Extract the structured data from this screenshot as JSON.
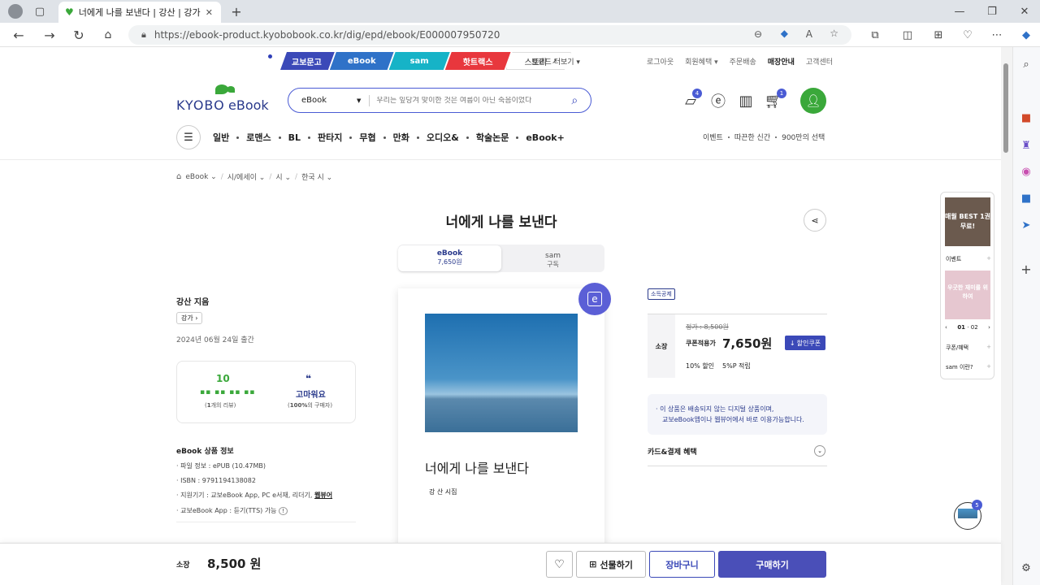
{
  "browser": {
    "tab_title": "너에게 나를 보낸다 | 강산 | 강가",
    "url": "https://ebook-product.kyobobook.co.kr/dig/epd/ebook/E000007950720"
  },
  "topnav": {
    "chips": [
      {
        "label": "교보문고",
        "color": "#3b49b8"
      },
      {
        "label": "eBook",
        "color": "#2f72c8"
      },
      {
        "label": "sam",
        "color": "#16b3c7"
      },
      {
        "label": "핫트랙스",
        "color": "#e8373d"
      },
      {
        "label": "스토리",
        "color": "#ffffff"
      }
    ],
    "brand_more": "브랜드 더보기",
    "utility": [
      "로그아웃",
      "회원혜택",
      "주문배송",
      "매장안내",
      "고객센터"
    ]
  },
  "logo": {
    "text1": "KYOBO",
    "text2": "eBook"
  },
  "search": {
    "category": "eBook",
    "placeholder": "우리는 잎당겨 맞이한 것은 여름이 아닌 죽음이었다"
  },
  "header_icons": {
    "coupon_badge": "4",
    "cart_badge": "1"
  },
  "gnb": {
    "items": [
      "일반",
      "로맨스",
      "BL",
      "판타지",
      "무협",
      "만화",
      "오디오&",
      "학술논문",
      "eBook+"
    ],
    "right": [
      "이벤트",
      "따끈한 신간",
      "900만의 선택"
    ]
  },
  "breadcrumb": [
    "eBook",
    "시/에세이",
    "시",
    "한국 시"
  ],
  "product": {
    "title": "너에게 나를 보낸다",
    "formats": [
      {
        "label": "eBook",
        "price": "7,650원"
      },
      {
        "label": "sam",
        "price": "구독"
      }
    ],
    "author": "강산 지음",
    "publisher": "강가",
    "pub_date": "2024년 06월 24일 출간",
    "rating": {
      "score": "10",
      "score_sub_a": "1",
      "score_sub_b": "개의 리뷰",
      "keyword": "고마워요",
      "kw_sub_a": "100%",
      "kw_sub_b": "의 구매자"
    },
    "info_title": "eBook 상품 정보",
    "info": [
      "파일 정보 : ePUB (10.47MB)",
      "ISBN : 9791194138082",
      "지원기기 : 교보eBook App, PC e서재, 리더기,",
      "교보eBook App : 듣기(TTS) 가능"
    ],
    "info_link": "웹뷰어",
    "cover_title": "너에게 나를 보낸다",
    "cover_author": "강 산  시집",
    "cover_badge": "e"
  },
  "price": {
    "tag": "소득공제",
    "own_label": "소장",
    "list_price": "정가 : 8,500원",
    "coupon_label": "쿠폰적용가",
    "sale_price": "7,650원",
    "coupon_btn": "할인쿠폰",
    "discount": "10% 할인",
    "points": "5%P 적립",
    "notice1": "이 상품은 배송되지 않는 디지털 상품이며,",
    "notice2": "교보eBook앱이나 웹뷰어에서 바로 이용가능합니다.",
    "card_benefit": "카드&결제 혜택"
  },
  "side_panel": {
    "banner1": "매월 BEST 1권 무료!",
    "event": "이벤트",
    "banner2": "우굿한 재미를 위하여",
    "pager": "01",
    "pager_total": "02",
    "links": [
      "쿠폰/혜택",
      "sam 이란?"
    ]
  },
  "recent_badge": "5",
  "bottom_bar": {
    "label": "소장",
    "price": "8,500 원",
    "gift": "선물하기",
    "cart": "장바구니",
    "buy": "구매하기"
  },
  "colors": {
    "accent": "#4a4fb8",
    "brand_green": "#3aa83a",
    "chip_blue": "#3b49b8"
  }
}
